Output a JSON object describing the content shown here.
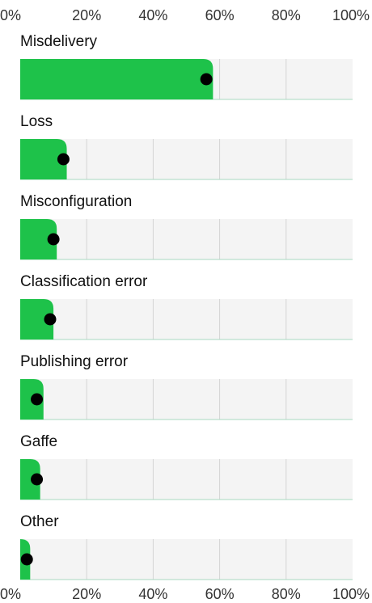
{
  "chart_data": {
    "type": "bar",
    "xlim": [
      0,
      100
    ],
    "tick_labels": [
      "0%",
      "20%",
      "40%",
      "60%",
      "80%",
      "100%"
    ],
    "categories": [
      "Misdelivery",
      "Loss",
      "Misconfiguration",
      "Classification error",
      "Publishing error",
      "Gaffe",
      "Other"
    ],
    "series": [
      {
        "values": [
          58,
          14,
          11,
          10,
          7,
          6,
          3
        ]
      },
      {
        "values": [
          56,
          13,
          10,
          9,
          5,
          5,
          2
        ]
      }
    ],
    "colors": {
      "bar": "#1ec24a",
      "dot": "#000000",
      "track": "#f4f4f4",
      "grid": "#d4d4d4",
      "baseline": "#a8d8c0"
    },
    "grid": true,
    "legend": "none"
  }
}
